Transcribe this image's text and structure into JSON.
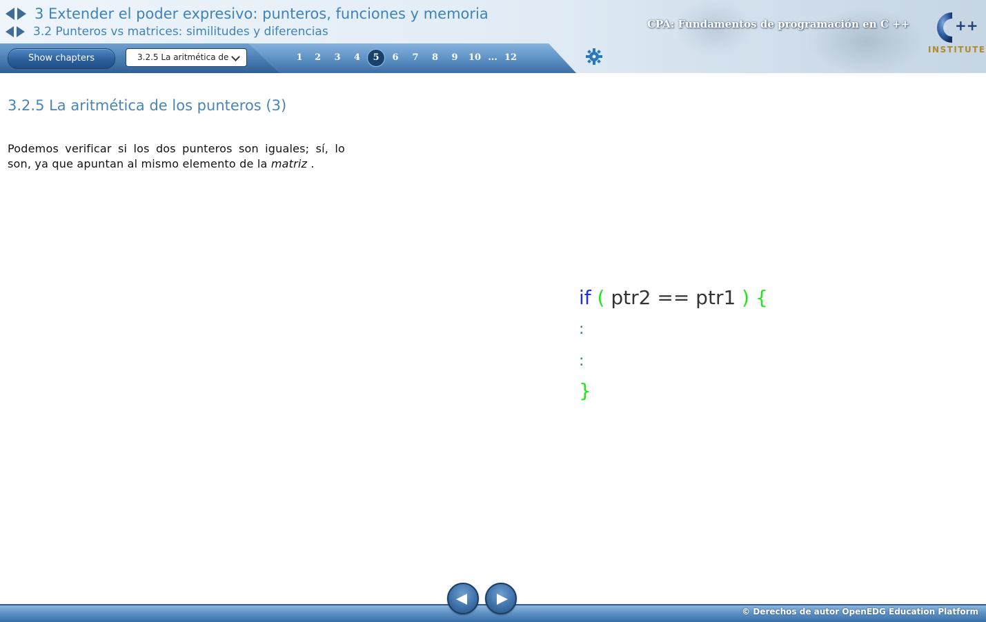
{
  "header": {
    "chapter_title": "3 Extender el poder expresivo: punteros, funciones y memoria",
    "section_title": "3.2 Punteros vs matrices: similitudes y diferencias",
    "course_title": "CPA: Fundamentos de programación en C ++",
    "logo_text": "INSTITUTE",
    "logo_mark": "++"
  },
  "toolbar": {
    "show_chapters_label": "Show chapters",
    "select_value": "3.2.5 La aritmética de",
    "pages": [
      "1",
      "2",
      "3",
      "4",
      "5",
      "6",
      "7",
      "8",
      "9",
      "10",
      "...",
      "12"
    ],
    "current_page": "5"
  },
  "content": {
    "lesson_title": "3.2.5 La aritmética de los punteros (3)",
    "paragraph_main": "Podemos verificar si los dos punteros son iguales; sí, lo son, ya que apuntan al mismo elemento de la",
    "paragraph_italic": "matriz",
    "paragraph_end": " .",
    "code": {
      "keyword": "if",
      "open_paren": "(",
      "expression": " ptr2 == ptr1 ",
      "close_paren": ")",
      "open_brace": "{",
      "dots1": ":",
      "dots2": ":",
      "close_brace": "}"
    }
  },
  "footer": {
    "copyright": "© Derechos de autor OpenEDG Education Platform"
  },
  "colors": {
    "title_blue": "#3f82b9",
    "toolbar_blue": "#2f5f93",
    "code_keyword": "#1d2fd8",
    "code_brace": "#1ee61a",
    "logo_gold": "#b08a2c"
  }
}
